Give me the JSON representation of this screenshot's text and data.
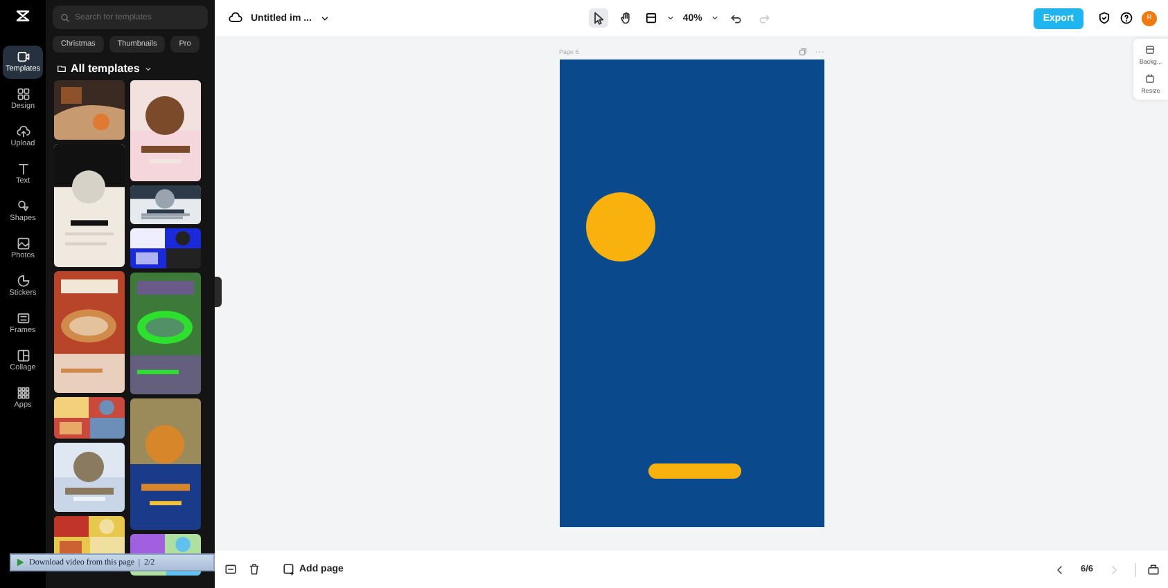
{
  "rail": [
    {
      "label": "Templates",
      "kind": "templates",
      "selected": true
    },
    {
      "label": "Design",
      "kind": "design",
      "selected": false
    },
    {
      "label": "Upload",
      "kind": "upload",
      "selected": false
    },
    {
      "label": "Text",
      "kind": "text",
      "selected": false
    },
    {
      "label": "Shapes",
      "kind": "shapes",
      "selected": false
    },
    {
      "label": "Photos",
      "kind": "photos",
      "selected": false
    },
    {
      "label": "Stickers",
      "kind": "stickers",
      "selected": false
    },
    {
      "label": "Frames",
      "kind": "frames",
      "selected": false
    },
    {
      "label": "Collage",
      "kind": "collage",
      "selected": false
    },
    {
      "label": "Apps",
      "kind": "apps",
      "selected": false
    }
  ],
  "panel": {
    "search": {
      "placeholder": "Search for templates"
    },
    "chips": [
      "Christmas",
      "Thumbnails",
      "Pro"
    ],
    "heading": "All templates"
  },
  "download_bar": {
    "label": "Download video from this page",
    "count": "2/2"
  },
  "topbar": {
    "title": "Untitled im ...",
    "tools": [
      {
        "kind": "select",
        "selected": true
      },
      {
        "kind": "hand",
        "selected": false
      }
    ],
    "zoom": "40%",
    "undo_disabled": false,
    "redo_disabled": true,
    "export": "Export",
    "avatar": "R"
  },
  "side_tools": [
    {
      "kind": "background",
      "label": "Backg..."
    },
    {
      "kind": "resize",
      "label": "Resize"
    }
  ],
  "page": {
    "label": "Page 6"
  },
  "footer": {
    "add_page": "Add page",
    "pager": "6/6",
    "prev_disabled": false,
    "next_disabled": true
  }
}
